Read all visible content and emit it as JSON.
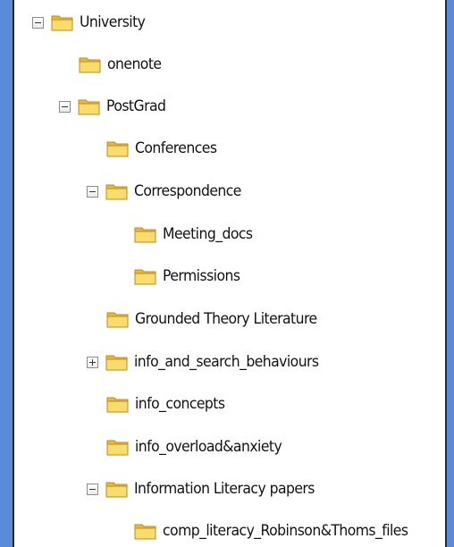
{
  "tree": {
    "nodes": [
      {
        "label": "University",
        "expander": "minus"
      },
      {
        "label": "onenote",
        "expander": "none"
      },
      {
        "label": "PostGrad",
        "expander": "minus"
      },
      {
        "label": "Conferences",
        "expander": "none"
      },
      {
        "label": "Correspondence",
        "expander": "minus"
      },
      {
        "label": "Meeting_docs",
        "expander": "none"
      },
      {
        "label": "Permissions",
        "expander": "none"
      },
      {
        "label": "Grounded Theory Literature",
        "expander": "none"
      },
      {
        "label": "info_and_search_behaviours",
        "expander": "plus"
      },
      {
        "label": "info_concepts",
        "expander": "none"
      },
      {
        "label": "info_overload&anxiety",
        "expander": "none"
      },
      {
        "label": "Information Literacy papers",
        "expander": "minus"
      },
      {
        "label": "comp_literacy_Robinson&Thoms_files",
        "expander": "none"
      }
    ]
  },
  "icons": {
    "folder": "folder-icon",
    "expand": "expand-plus-icon",
    "collapse": "collapse-minus-icon"
  },
  "colors": {
    "background": "#5b8ad8",
    "panel": "#ffffff",
    "folder_fill": "#f4c94a",
    "folder_front": "#f9dc6e",
    "folder_outline": "#c08a18"
  }
}
